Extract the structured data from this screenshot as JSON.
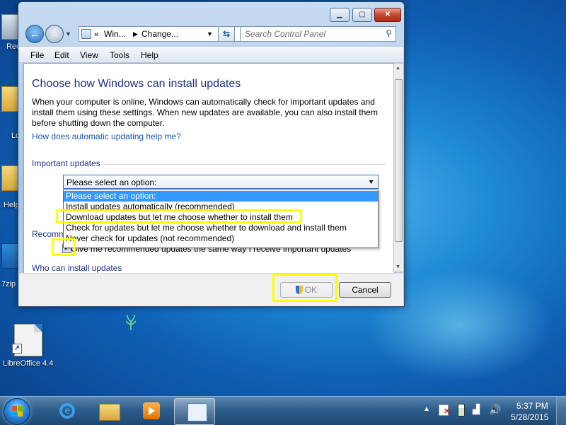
{
  "window": {
    "address_parts": [
      "Win...",
      "Change..."
    ],
    "search_placeholder": "Search Control Panel",
    "menu": [
      "File",
      "Edit",
      "View",
      "Tools",
      "Help"
    ]
  },
  "page": {
    "title": "Choose how Windows can install updates",
    "description": "When your computer is online, Windows can automatically check for important updates and install them using these settings. When new updates are available, you can also install them before shutting down the computer.",
    "help_link": "How does automatic updating help me?",
    "important_updates_label": "Important updates",
    "important_updates_selected": "Please select an option:",
    "important_updates_options": [
      "Please select an option:",
      "Install updates automatically (recommended)",
      "Download updates but let me choose whether to install them",
      "Check for updates but let me choose whether to download and install them",
      "Never check for updates (not recommended)"
    ],
    "recommended_label_partial": "Recomm",
    "recommended_checkbox_label": "Give me recommended updates the same way I receive important updates",
    "recommended_checked": true,
    "who_label": "Who can install updates"
  },
  "buttons": {
    "ok": "OK",
    "cancel": "Cancel",
    "ok_enabled": false
  },
  "desktop": {
    "icon_labels": [
      "Rec",
      "Lo",
      "Help",
      "7zip",
      "LibreOffice 4.4"
    ]
  },
  "taskbar": {
    "time": "5:37 PM",
    "date": "5/28/2015"
  }
}
